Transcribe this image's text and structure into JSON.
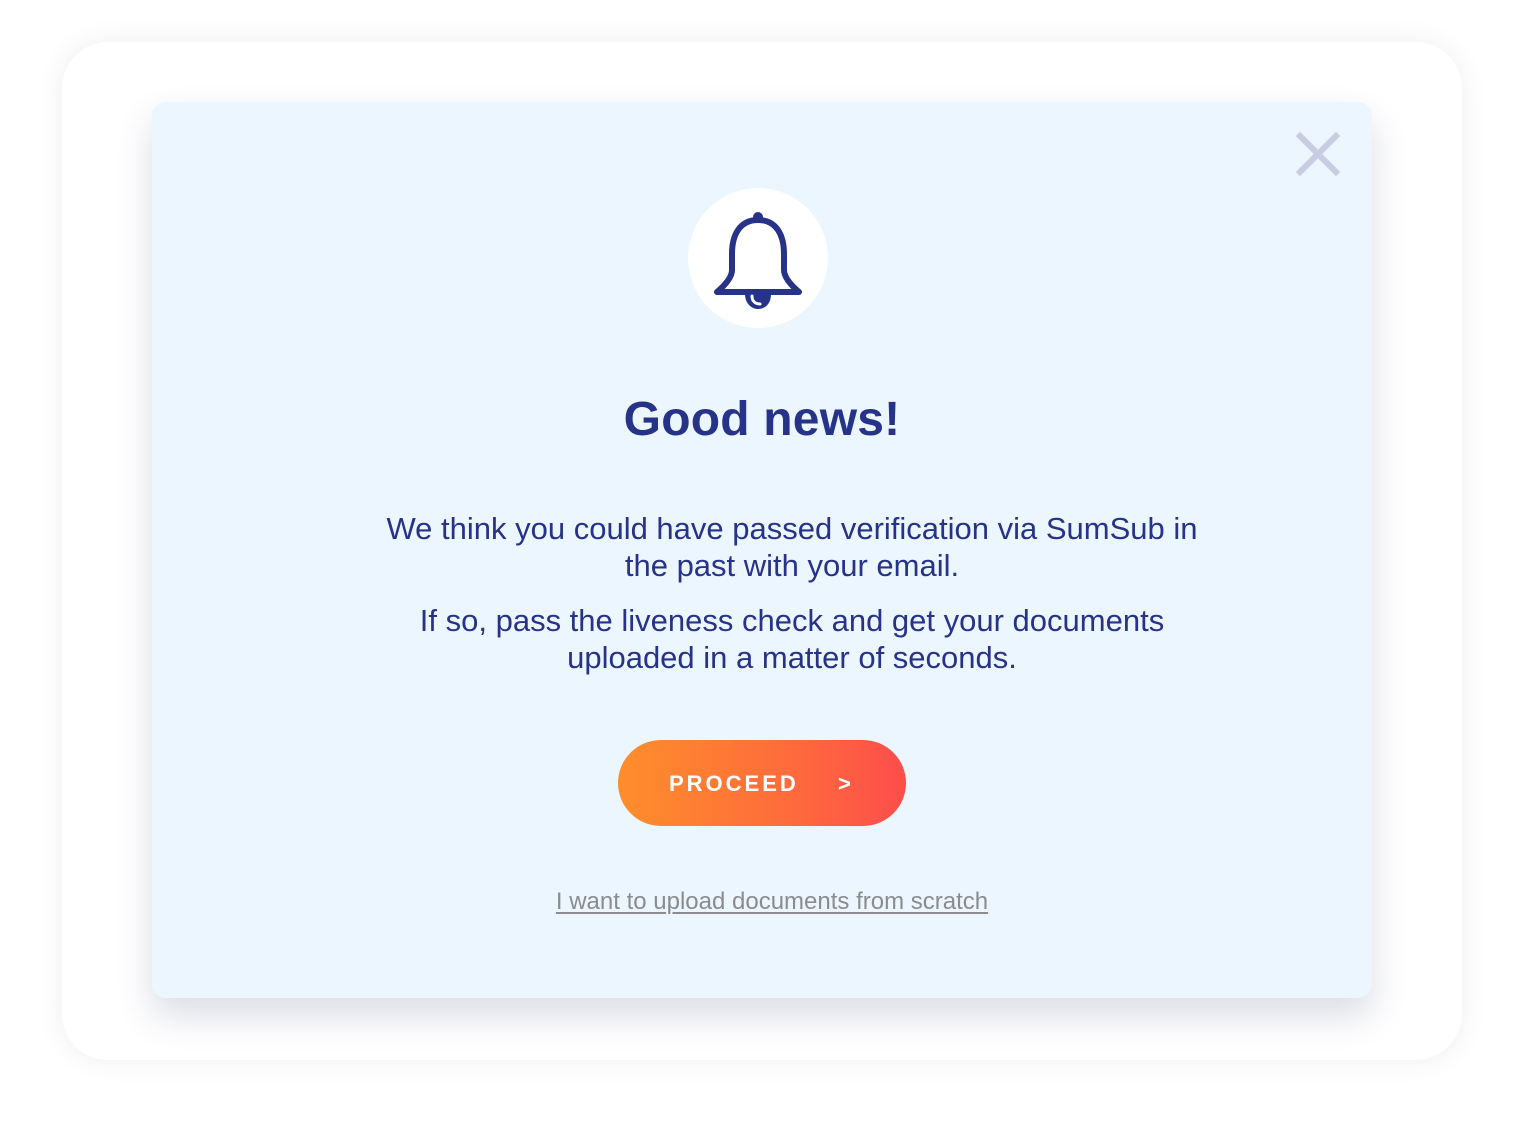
{
  "modal": {
    "title": "Good news!",
    "paragraph_1": {
      "line_1": "We think you could have passed verification via SumSub in",
      "line_2": "the past with your email."
    },
    "paragraph_2": {
      "line_1": "If so, pass the liveness check and get your documents",
      "line_2": "uploaded in a matter of seconds."
    },
    "proceed_button": {
      "label": "PROCEED",
      "arrow": ">"
    },
    "upload_link": "I want to upload documents from scratch",
    "icons": {
      "header": "bell-icon",
      "close": "close-icon"
    }
  },
  "colors": {
    "text_primary": "#273289",
    "modal_background": "#ecf6fe",
    "button_gradient_start": "#fe8e2b",
    "button_gradient_end": "#fd4d4b",
    "link_text": "#8a8c90",
    "close_icon": "#c9cde2"
  }
}
